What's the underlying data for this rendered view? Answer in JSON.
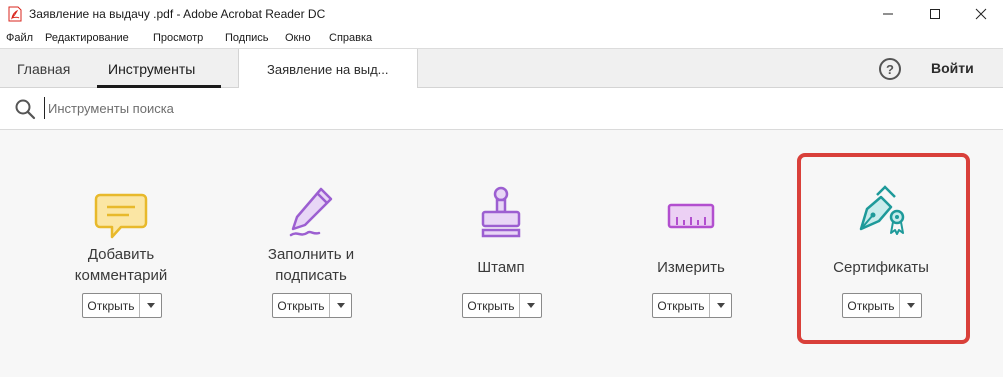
{
  "window": {
    "title": "Заявление на выдачу .pdf - Adobe Acrobat Reader DC",
    "controls": [
      "minimize",
      "maximize",
      "close"
    ]
  },
  "menu": {
    "items": [
      "Файл",
      "Редактирование",
      "Просмотр",
      "Подпись",
      "Окно",
      "Справка"
    ]
  },
  "tabs": {
    "home": "Главная",
    "tools": "Инструменты",
    "document": "Заявление на выд...",
    "help_symbol": "?",
    "signin": "Войти"
  },
  "search": {
    "placeholder": "Инструменты поиска",
    "value": ""
  },
  "tools": [
    {
      "label_line1": "Добавить",
      "label_line2": "комментарий",
      "open_label": "Открыть",
      "icon": "comment-icon",
      "color": "#e8b92b"
    },
    {
      "label_line1": "Заполнить и",
      "label_line2": "подписать",
      "open_label": "Открыть",
      "icon": "fill-sign-icon",
      "color": "#9c5fd1"
    },
    {
      "label_line1": "Штамп",
      "label_line2": "",
      "open_label": "Открыть",
      "icon": "stamp-icon",
      "color": "#9c5fd1"
    },
    {
      "label_line1": "Измерить",
      "label_line2": "",
      "open_label": "Открыть",
      "icon": "measure-icon",
      "color": "#b24fcf"
    },
    {
      "label_line1": "Сертификаты",
      "label_line2": "",
      "open_label": "Открыть",
      "icon": "certificate-icon",
      "color": "#1e9a9a",
      "highlighted": true
    }
  ],
  "colors": {
    "highlight": "#d9403a",
    "acrobat_red": "#d9251c"
  }
}
